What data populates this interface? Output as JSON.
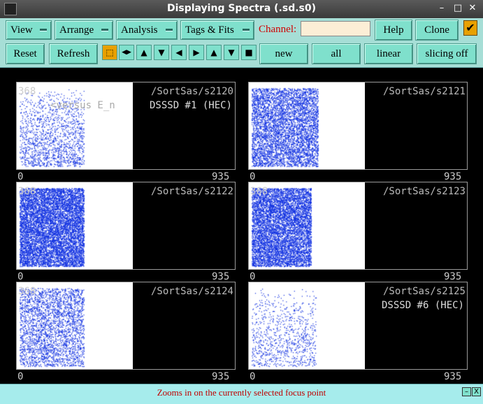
{
  "window": {
    "title": "Displaying Spectra (.sd.s0)"
  },
  "menus": {
    "view": "View",
    "arrange": "Arrange",
    "analysis": "Analysis",
    "tags_fits": "Tags & Fits"
  },
  "channel": {
    "label": "Channel:",
    "value": ""
  },
  "buttons": {
    "help": "Help",
    "clone": "Clone",
    "reset": "Reset",
    "refresh": "Refresh",
    "new": "new",
    "all": "all",
    "linear": "linear",
    "slicing": "slicing off"
  },
  "icons": {
    "focus_zoom": "⬚",
    "expand_h": "◀▶",
    "expand_up": "▲",
    "expand_down": "▼",
    "left": "◀",
    "right": "▶",
    "up": "▲",
    "down": "▼",
    "stop": "■",
    "check": "✔"
  },
  "spectra": [
    {
      "path": "/SortSas/s2120",
      "subtitle": "DSSSD #1 (HEC)",
      "ymax": "368",
      "overlay": "<versus E_n",
      "xmin": "0",
      "xmax": "935",
      "color": "#1030e0",
      "level": 0.15
    },
    {
      "path": "/SortSas/s2121",
      "subtitle": "",
      "ymax": "",
      "overlay": "",
      "xmin": "0",
      "xmax": "935",
      "color": "#1030e0",
      "level": 0.55
    },
    {
      "path": "/SortSas/s2122",
      "subtitle": "",
      "ymax": "368",
      "overlay": "",
      "xmin": "0",
      "xmax": "935",
      "color": "#1030e0",
      "level": 0.9
    },
    {
      "path": "/SortSas/s2123",
      "subtitle": "",
      "ymax": "368",
      "overlay": "",
      "xmin": "0",
      "xmax": "935",
      "color": "#1030e0",
      "level": 0.75
    },
    {
      "path": "/SortSas/s2124",
      "subtitle": "",
      "ymax": "368",
      "overlay": "",
      "xmin": "0",
      "xmax": "935",
      "color": "#1030e0",
      "level": 0.3
    },
    {
      "path": "/SortSas/s2125",
      "subtitle": "DSSSD #6 (HEC)",
      "ymax": "",
      "overlay": "",
      "xmin": "0",
      "xmax": "935",
      "color": "#1030e0",
      "level": 0.08
    }
  ],
  "status": {
    "text": "Zooms in on the currently selected focus point",
    "min_icon": "–",
    "close_icon": "X"
  }
}
